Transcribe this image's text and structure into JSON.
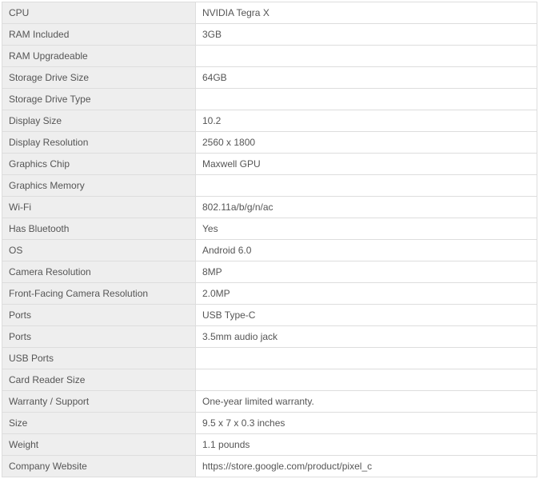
{
  "specs": [
    {
      "label": "CPU",
      "value": "NVIDIA Tegra X"
    },
    {
      "label": "RAM Included",
      "value": "3GB"
    },
    {
      "label": "RAM Upgradeable",
      "value": ""
    },
    {
      "label": "Storage Drive Size",
      "value": "64GB"
    },
    {
      "label": "Storage Drive Type",
      "value": ""
    },
    {
      "label": "Display Size",
      "value": "10.2"
    },
    {
      "label": "Display Resolution",
      "value": "2560 x 1800"
    },
    {
      "label": "Graphics Chip",
      "value": "Maxwell GPU"
    },
    {
      "label": "Graphics Memory",
      "value": ""
    },
    {
      "label": "Wi-Fi",
      "value": "802.11a/b/g/n/ac"
    },
    {
      "label": "Has Bluetooth",
      "value": "Yes"
    },
    {
      "label": "OS",
      "value": "Android 6.0"
    },
    {
      "label": "Camera Resolution",
      "value": "8MP"
    },
    {
      "label": "Front-Facing Camera Resolution",
      "value": "2.0MP"
    },
    {
      "label": "Ports",
      "value": "USB Type-C"
    },
    {
      "label": "Ports",
      "value": "3.5mm audio jack"
    },
    {
      "label": "USB Ports",
      "value": ""
    },
    {
      "label": "Card Reader Size",
      "value": ""
    },
    {
      "label": "Warranty / Support",
      "value": "One-year limited warranty."
    },
    {
      "label": "Size",
      "value": "9.5 x 7 x 0.3 inches"
    },
    {
      "label": "Weight",
      "value": "1.1 pounds"
    },
    {
      "label": "Company Website",
      "value": "https://store.google.com/product/pixel_c"
    }
  ]
}
